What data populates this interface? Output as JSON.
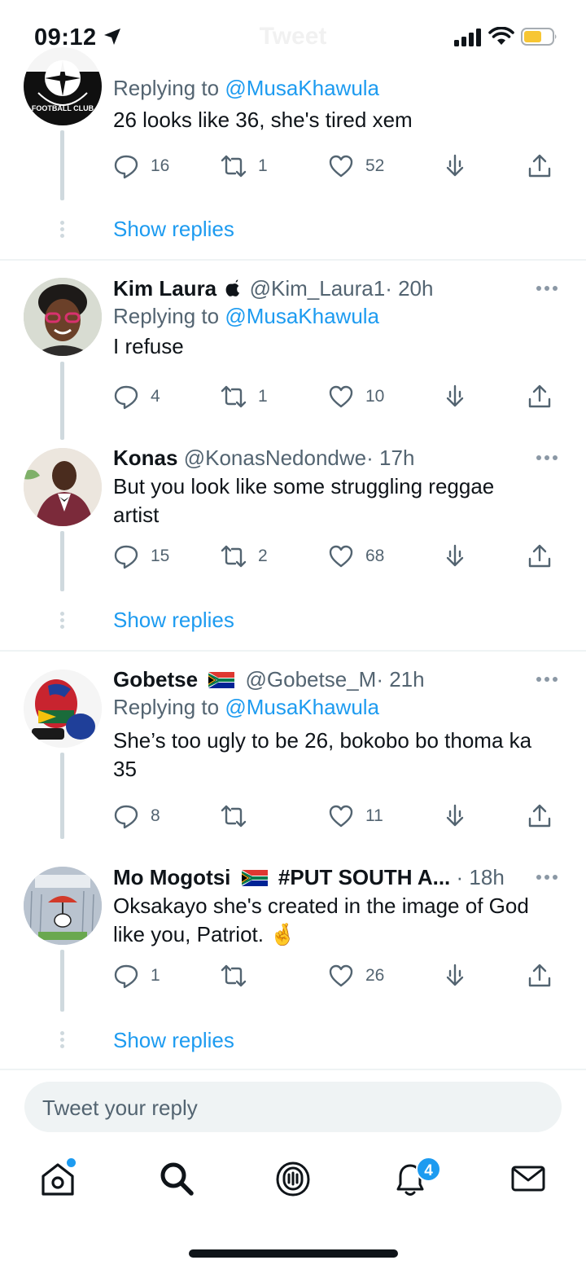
{
  "status_bar": {
    "time": "09:12",
    "faded_title": "Tweet"
  },
  "tweets": [
    {
      "reply_to_label": "Replying to",
      "reply_to_mention": "@MusaKhawula",
      "text": "26 looks like 36, she's tired xem",
      "replies": "16",
      "retweets": "1",
      "likes": "52",
      "show_replies": "Show replies"
    },
    {
      "name": "Kim Laura",
      "handle": "@Kim_Laura1",
      "time": "· 20h",
      "reply_to_label": "Replying to",
      "reply_to_mention": "@MusaKhawula",
      "text": "I refuse",
      "replies": "4",
      "retweets": "1",
      "likes": "10"
    },
    {
      "name": "Konas",
      "handle": "@KonasNedondwe",
      "time": "· 17h",
      "text": "But you look like some struggling reggae artist",
      "replies": "15",
      "retweets": "2",
      "likes": "68",
      "show_replies": "Show replies"
    },
    {
      "name": "Gobetse",
      "handle": "@Gobetse_M",
      "time": "· 21h",
      "reply_to_label": "Replying to",
      "reply_to_mention": "@MusaKhawula",
      "text": "She’s too ugly to be 26, bokobo bo thoma ka 35",
      "replies": "8",
      "retweets": "",
      "likes": "11"
    },
    {
      "name": "Mo Mogotsi",
      "name_suffix": "#PUT SOUTH A...",
      "time": "· 18h",
      "text": "Oksakayo she's created in the image of God like you, Patriot.",
      "emoji": "🤞",
      "replies": "1",
      "retweets": "",
      "likes": "26",
      "show_replies": "Show replies"
    }
  ],
  "reply_box": {
    "placeholder": "Tweet your reply"
  },
  "tab_bar": {
    "tabs": [
      "home-icon",
      "search-icon",
      "spaces-icon",
      "notifications-icon",
      "messages-icon"
    ],
    "notifications_badge": "4"
  },
  "colors": {
    "accent": "#1d9bf0",
    "text": "#0f1419",
    "muted": "#536471",
    "line": "#cfd9de"
  },
  "avatar_lettering": "FOOTBALL CLUB"
}
